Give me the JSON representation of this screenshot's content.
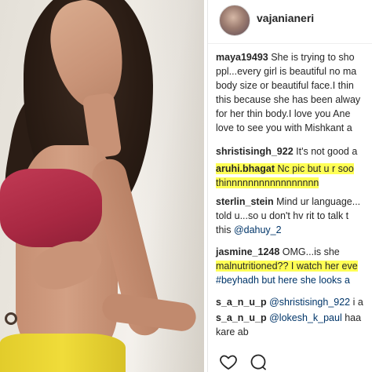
{
  "post": {
    "username": "vajanianeri"
  },
  "comments": [
    {
      "user": "maya19493",
      "lines": [
        "She is trying to sho",
        "ppl...every girl is beautiful no ma",
        "body size or beautiful face.I thin",
        "this because she has been alway",
        "for her thin body.I love you Ane",
        "love to see you with Mishkant a"
      ]
    },
    {
      "user": "shristisingh_922",
      "lines": [
        "It's not good a"
      ]
    },
    {
      "user": "aruhi.bhagat",
      "lines": [
        "Nc pic but u r soo",
        "thinnnnnnnnnnnnnnnnn"
      ]
    },
    {
      "user": "sterlin_stein",
      "lines": [
        "Mind ur language...",
        "told u...so u don't hv rit to talk t",
        "this"
      ],
      "mention": "@dahuy_2"
    },
    {
      "user": "jasmine_1248",
      "lines": [
        "OMG...is she",
        "malnutritioned?? I watch her eve",
        "#beyhadh but here she looks a"
      ]
    },
    {
      "user": "s_a_n_u_p",
      "mention": "@shristisingh_922",
      "lines": [
        "i a"
      ]
    },
    {
      "user": "s_a_n_u_p",
      "mention": "@lokesh_k_paul",
      "lines": [
        "haa",
        "kare ab"
      ]
    }
  ],
  "icons": [
    "heart-icon",
    "comment-icon"
  ],
  "colors": {
    "highlight": "#ffff55",
    "text": "#262626",
    "mention": "#003569"
  }
}
